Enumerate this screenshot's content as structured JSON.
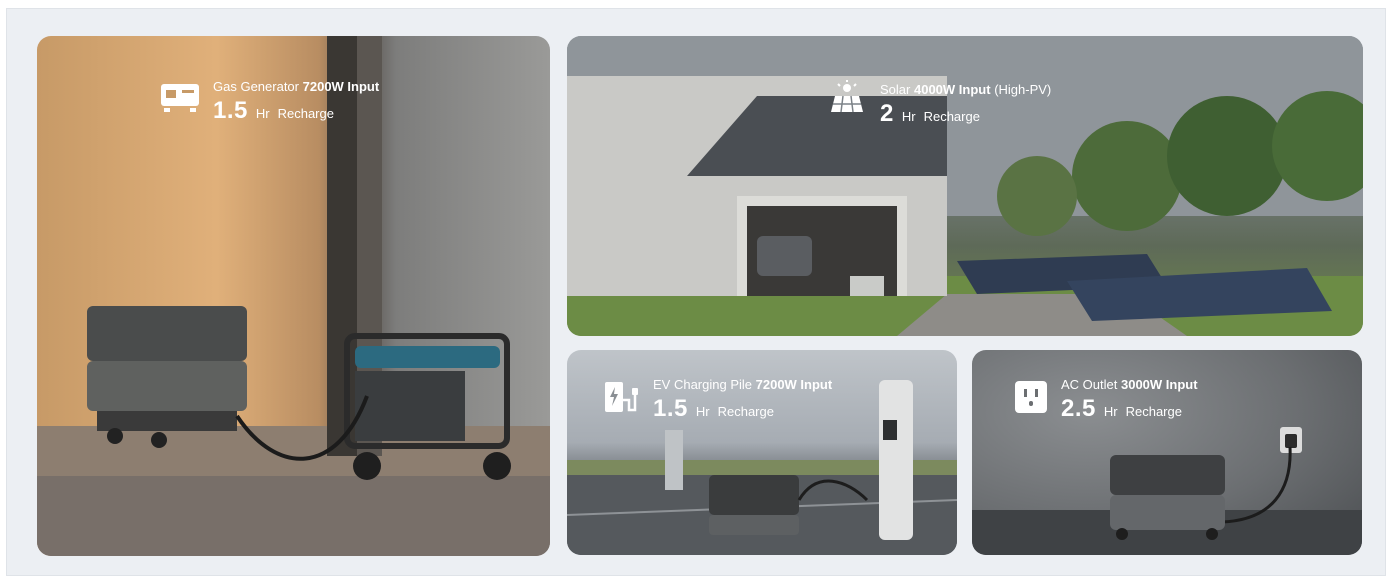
{
  "cards": [
    {
      "id": "gas",
      "source": "Gas Generator",
      "power": "7200W Input",
      "extra": "",
      "hours": "1.5",
      "unit": "Hr",
      "label": "Recharge",
      "icon": "gas-generator-icon"
    },
    {
      "id": "solar",
      "source": "Solar",
      "power": "4000W Input",
      "extra": "(High-PV)",
      "hours": "2",
      "unit": "Hr",
      "label": "Recharge",
      "icon": "solar-panel-icon"
    },
    {
      "id": "ev",
      "source": "EV Charging Pile",
      "power": "7200W Input",
      "extra": "",
      "hours": "1.5",
      "unit": "Hr",
      "label": "Recharge",
      "icon": "ev-charger-icon"
    },
    {
      "id": "ac",
      "source": "AC Outlet",
      "power": "3000W Input",
      "extra": "",
      "hours": "2.5",
      "unit": "Hr",
      "label": "Recharge",
      "icon": "ac-outlet-icon"
    }
  ]
}
